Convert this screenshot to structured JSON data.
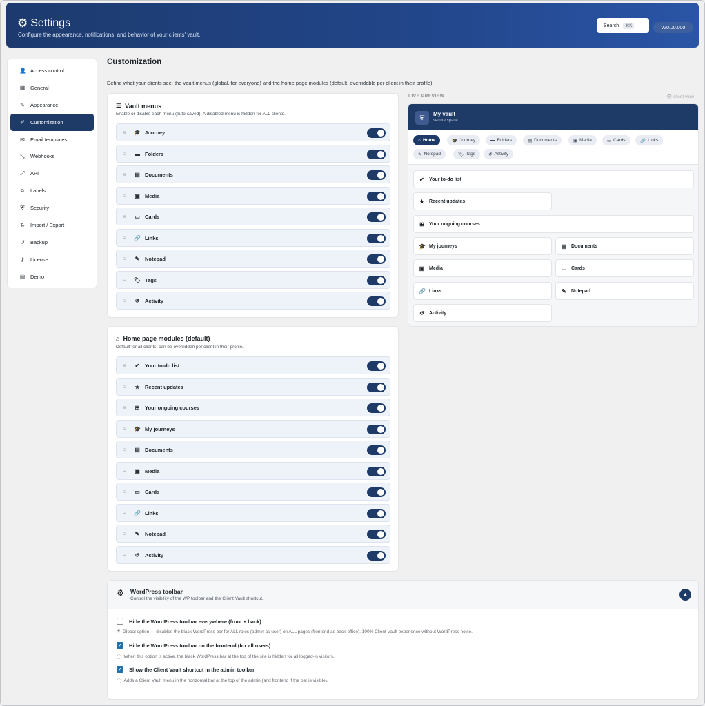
{
  "header": {
    "title": "Settings",
    "subtitle": "Configure the appearance, notifications, and behavior of your clients' vault.",
    "search_label": "Search",
    "search_shortcut": "⌘K",
    "version": "v20.00.000"
  },
  "sidebar": {
    "items": [
      {
        "label": "Access control",
        "icon": "user-icon"
      },
      {
        "label": "General",
        "icon": "grid-icon"
      },
      {
        "label": "Appearance",
        "icon": "brush-icon"
      },
      {
        "label": "Customization",
        "icon": "edit-icon",
        "active": true
      },
      {
        "label": "Email templates",
        "icon": "mail-icon"
      },
      {
        "label": "Webhooks",
        "icon": "webhook-icon"
      },
      {
        "label": "API",
        "icon": "api-icon"
      },
      {
        "label": "Labels",
        "icon": "labels-icon"
      },
      {
        "label": "Security",
        "icon": "shield-icon"
      },
      {
        "label": "Import / Export",
        "icon": "import-export-icon"
      },
      {
        "label": "Backup",
        "icon": "backup-icon"
      },
      {
        "label": "License",
        "icon": "key-icon"
      },
      {
        "label": "Demo",
        "icon": "demo-icon"
      }
    ]
  },
  "main": {
    "title": "Customization",
    "description": "Define what your clients see: the vault menus (global, for everyone) and the home page modules (default, overridable per client in their profile)."
  },
  "vault_menus": {
    "title": "Vault menus",
    "subtitle": "Enable or disable each menu (auto-saved). A disabled menu is hidden for ALL clients.",
    "items": [
      {
        "label": "Journey",
        "enabled": true
      },
      {
        "label": "Folders",
        "enabled": true
      },
      {
        "label": "Documents",
        "enabled": true
      },
      {
        "label": "Media",
        "enabled": true
      },
      {
        "label": "Cards",
        "enabled": true
      },
      {
        "label": "Links",
        "enabled": true
      },
      {
        "label": "Notepad",
        "enabled": true
      },
      {
        "label": "Tags",
        "enabled": true
      },
      {
        "label": "Activity",
        "enabled": true
      }
    ]
  },
  "home_modules": {
    "title": "Home page modules (default)",
    "subtitle": "Default for all clients; can be overridden per client in their profile.",
    "items": [
      {
        "label": "Your to-do list",
        "enabled": true
      },
      {
        "label": "Recent updates",
        "enabled": true
      },
      {
        "label": "Your ongoing courses",
        "enabled": true
      },
      {
        "label": "My journeys",
        "enabled": true
      },
      {
        "label": "Documents",
        "enabled": true
      },
      {
        "label": "Media",
        "enabled": true
      },
      {
        "label": "Cards",
        "enabled": true
      },
      {
        "label": "Links",
        "enabled": true
      },
      {
        "label": "Notepad",
        "enabled": true
      },
      {
        "label": "Activity",
        "enabled": true
      }
    ]
  },
  "preview": {
    "label": "LIVE PREVIEW",
    "view_label": "client view",
    "vault_name": "My vault",
    "vault_tagline": "secure space",
    "tabs": [
      "Home",
      "Journey",
      "Folders",
      "Documents",
      "Media",
      "Cards",
      "Links",
      "Notepad",
      "Tags",
      "Activity"
    ],
    "cards": [
      "Your to-do list",
      "Recent updates",
      "Your ongoing courses",
      "My journeys",
      "Documents",
      "Media",
      "Cards",
      "Links",
      "Notepad",
      "Activity"
    ]
  },
  "wp_toolbar": {
    "title": "WordPress toolbar",
    "subtitle": "Control the visibility of the WP toolbar and the Client Vault shortcut.",
    "options": [
      {
        "label": "Hide the WordPress toolbar everywhere (front + back)",
        "checked": false,
        "help": "Global option — disables the black WordPress bar for ALL roles (admin as user) on ALL pages (frontend as back-office). 100% Client Vault experience without WordPress noise."
      },
      {
        "label": "Hide the WordPress toolbar on the frontend (for all users)",
        "checked": true,
        "help": "When this option is active, the black WordPress bar at the top of the site is hidden for all logged-in visitors."
      },
      {
        "label": "Show the Client Vault shortcut in the admin toolbar",
        "checked": true,
        "help": "Adds a Client Vault menu in the horizontal bar at the top of the admin (and frontend if the bar is visible)."
      }
    ]
  }
}
